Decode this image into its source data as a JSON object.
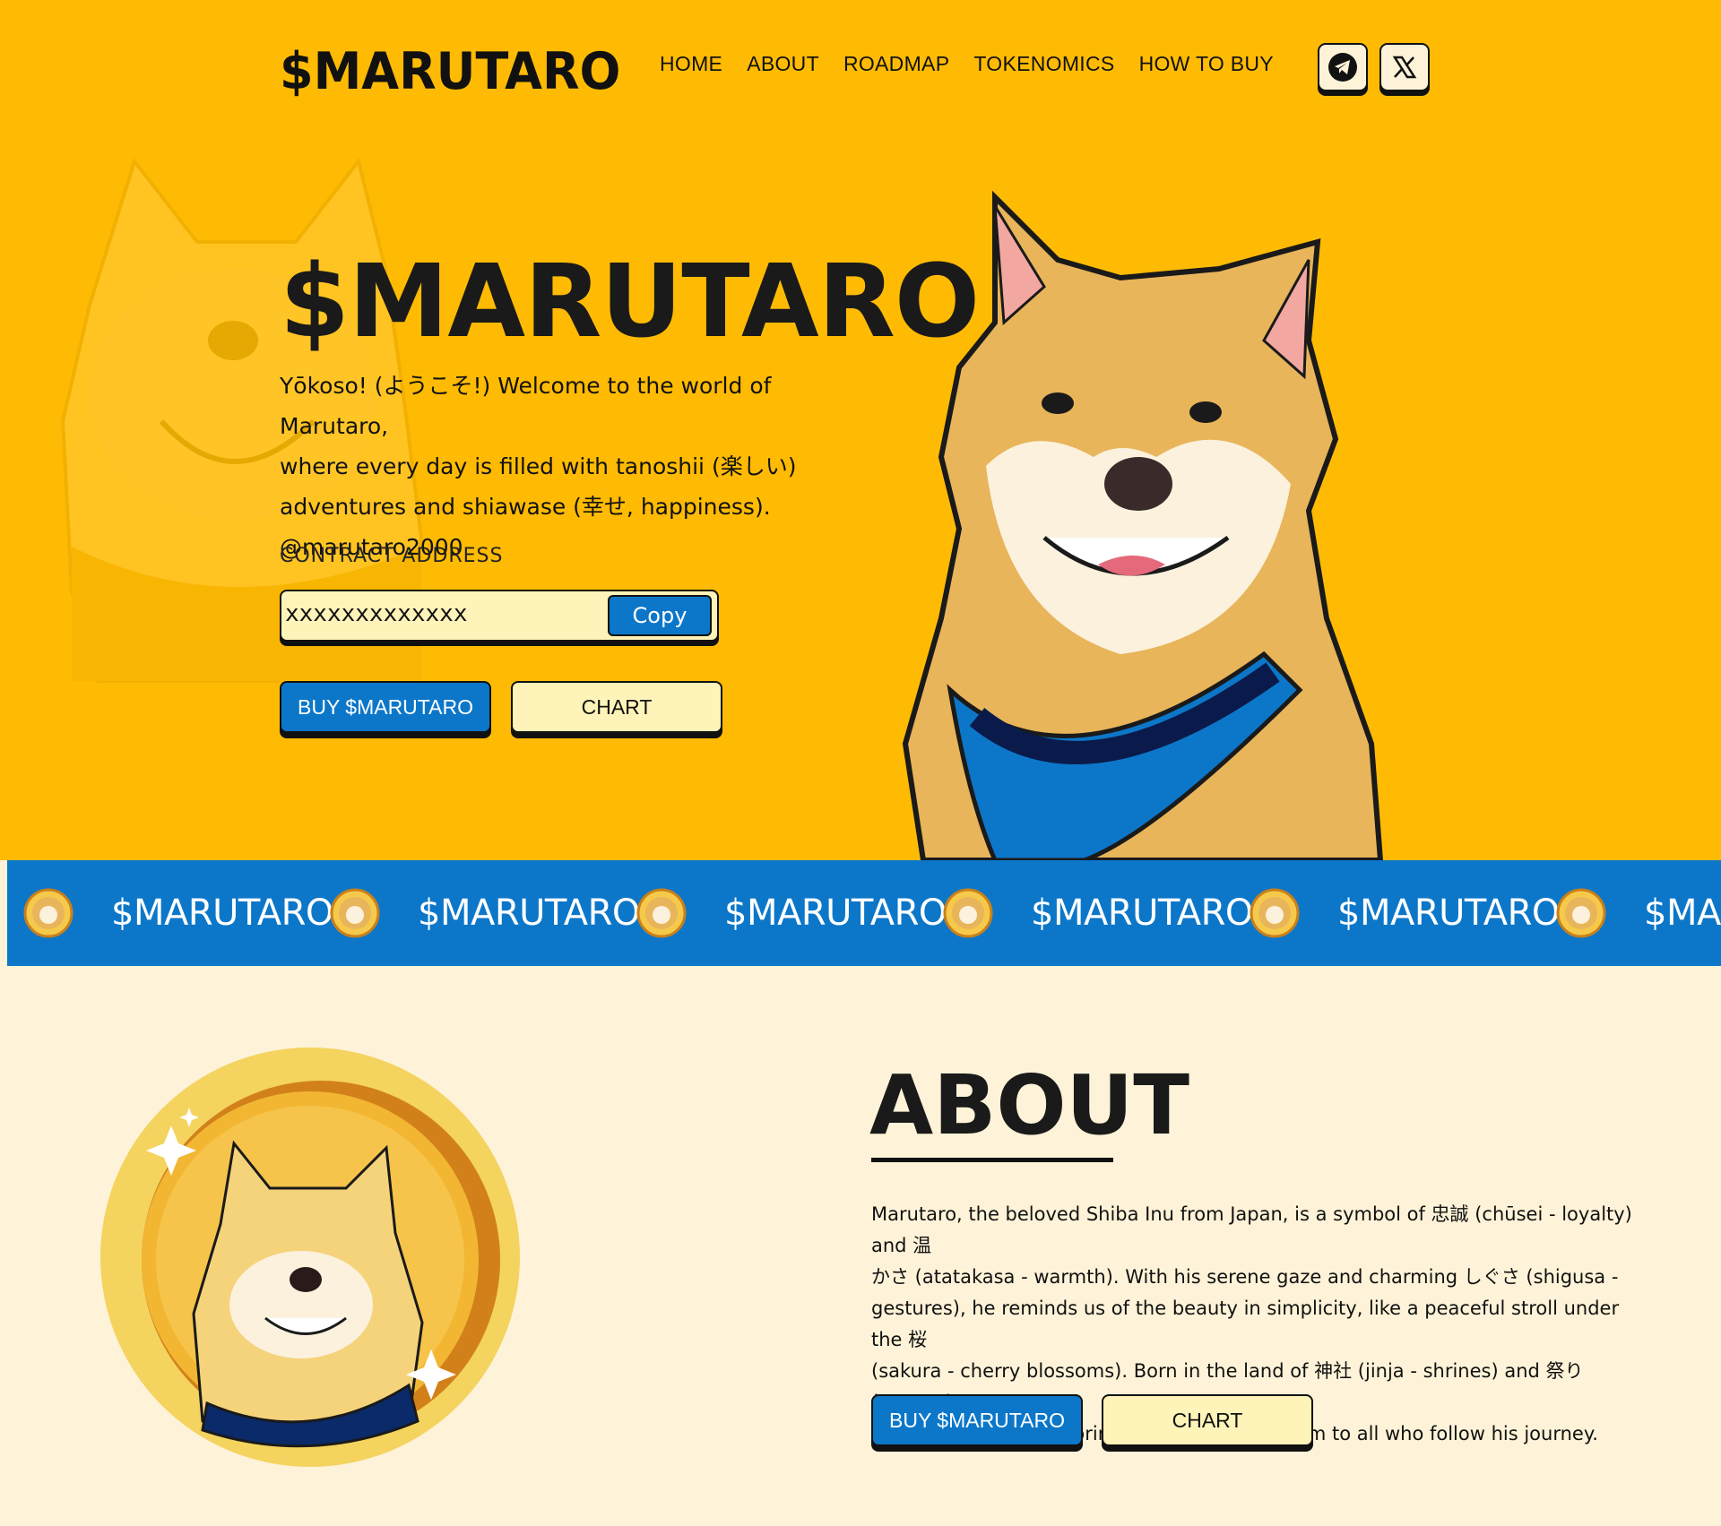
{
  "nav": {
    "logo": "$MARUTARO",
    "links": [
      "HOME",
      "ABOUT",
      "ROADMAP",
      "TOKENOMICS",
      "HOW TO BUY"
    ]
  },
  "social": {
    "telegram_icon": "telegram-icon",
    "x_icon": "x-icon"
  },
  "hero": {
    "title": "$MARUTARO",
    "line1": "Yōkoso! (ようこそ!) Welcome to the world of Marutaro,",
    "line2": "where every day is filled with tanoshii (楽しい)",
    "line3": "adventures and shiawase (幸せ, happiness).",
    "handle": "@marutaro2000",
    "contract_label": "CONTRACT ADDRESS",
    "contract_value": "xxxxxxxxxxxxx",
    "copy_label": "Copy",
    "buy_label": "BUY $MARUTARO",
    "chart_label": "CHART"
  },
  "ticker": {
    "text": "$MARUTARO"
  },
  "about": {
    "title": "ABOUT",
    "l1": "Marutaro, the beloved Shiba Inu from Japan, is a symbol of 忠誠 (chūsei - loyalty) and 温",
    "l2": "かさ (atatakasa - warmth). With his serene gaze and charming しぐさ (shigusa -",
    "l3": "gestures), he reminds us of the beauty in simplicity, like a peaceful stroll under the 桜",
    "l4": "(sakura - cherry blossoms). Born in the land of 神社 (jinja - shrines) and 祭り (matsuri",
    "l5": "- festivals), Marutaro brings happiness and calm to all who follow his journey.",
    "buy_label": "BUY $MARUTARO",
    "chart_label": "CHART"
  },
  "colors": {
    "hero_bg": "#FFBB03",
    "accent_blue": "#0C77C9",
    "cream": "#FEF3D8",
    "button_cream": "#FEF3B8"
  }
}
